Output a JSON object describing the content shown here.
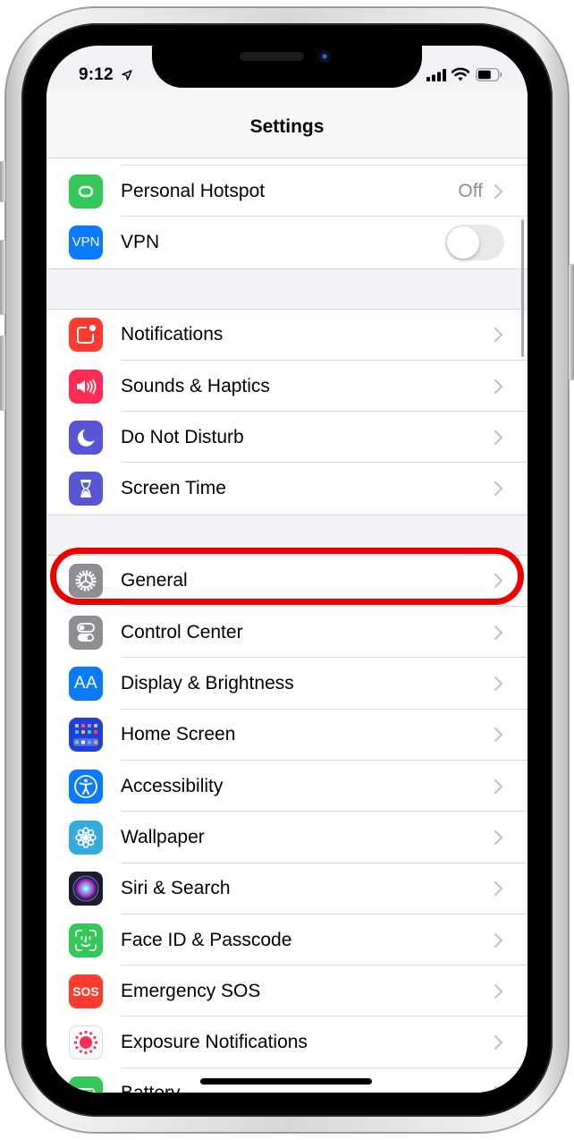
{
  "status_bar": {
    "time": "9:12",
    "icons": [
      "location-arrow-icon",
      "cellular-signal-icon",
      "wifi-icon",
      "battery-icon"
    ]
  },
  "nav": {
    "title": "Settings"
  },
  "groups": [
    {
      "rows": [
        {
          "label": "Personal Hotspot",
          "value": "Off",
          "icon": "personal-hotspot-icon",
          "icon_color": "#34C759",
          "accessory": "chevron"
        },
        {
          "label": "VPN",
          "icon": "vpn-icon",
          "icon_text": "VPN",
          "icon_color": "#0A7AFF",
          "accessory": "toggle",
          "toggle_on": false
        }
      ]
    },
    {
      "rows": [
        {
          "label": "Notifications",
          "icon": "notifications-icon",
          "icon_color": "#FF3B30",
          "accessory": "chevron"
        },
        {
          "label": "Sounds & Haptics",
          "icon": "speaker-icon",
          "icon_color": "#FF2D55",
          "accessory": "chevron"
        },
        {
          "label": "Do Not Disturb",
          "icon": "moon-icon",
          "icon_color": "#5856D6",
          "accessory": "chevron"
        },
        {
          "label": "Screen Time",
          "icon": "hourglass-icon",
          "icon_color": "#5856D6",
          "accessory": "chevron"
        }
      ]
    },
    {
      "rows": [
        {
          "label": "General",
          "icon": "gear-icon",
          "icon_color": "#8E8E93",
          "accessory": "chevron",
          "highlighted": true
        },
        {
          "label": "Control Center",
          "icon": "toggles-icon",
          "icon_color": "#8E8E93",
          "accessory": "chevron"
        },
        {
          "label": "Display & Brightness",
          "icon": "text-size-icon",
          "icon_text": "AA",
          "icon_color": "#0A7AFF",
          "accessory": "chevron"
        },
        {
          "label": "Home Screen",
          "icon": "home-screen-grid-icon",
          "icon_color": "#1F3FD8",
          "accessory": "chevron"
        },
        {
          "label": "Accessibility",
          "icon": "accessibility-icon",
          "icon_color": "#0A7AFF",
          "accessory": "chevron"
        },
        {
          "label": "Wallpaper",
          "icon": "wallpaper-flower-icon",
          "icon_color": "#35AADC",
          "accessory": "chevron"
        },
        {
          "label": "Siri & Search",
          "icon": "siri-icon",
          "icon_color": "#1C1C2E",
          "accessory": "chevron"
        },
        {
          "label": "Face ID & Passcode",
          "icon": "face-id-icon",
          "icon_color": "#34C759",
          "accessory": "chevron"
        },
        {
          "label": "Emergency SOS",
          "icon": "sos-icon",
          "icon_text": "SOS",
          "icon_color": "#FF3B30",
          "accessory": "chevron"
        },
        {
          "label": "Exposure Notifications",
          "icon": "exposure-notifications-icon",
          "icon_color": "#FFFFFF",
          "accessory": "chevron"
        },
        {
          "label": "Battery",
          "icon": "battery-settings-icon",
          "icon_color": "#34C759",
          "accessory": "chevron"
        }
      ]
    }
  ],
  "annotation": {
    "highlight_color": "#EF0000",
    "target": "General"
  }
}
